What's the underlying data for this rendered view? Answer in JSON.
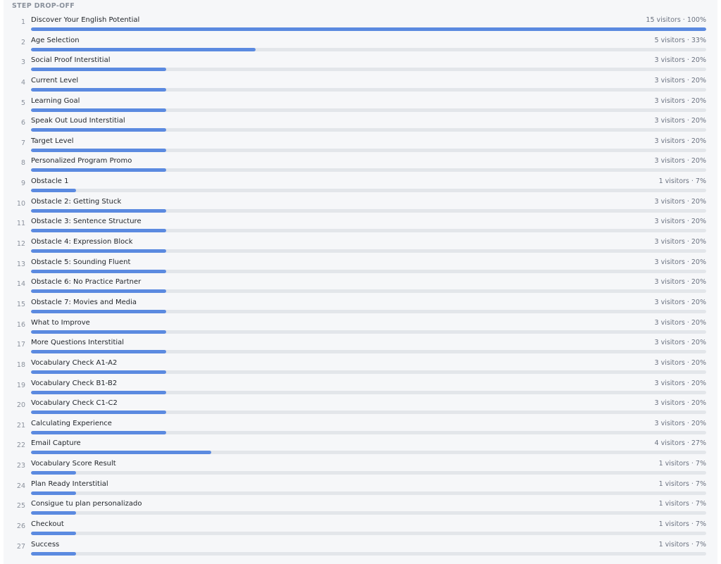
{
  "section": {
    "title": "STEP DROP-OFF"
  },
  "colors": {
    "bar_fill": "#5b8ae0",
    "bar_track": "#e3e6ea"
  },
  "steps": [
    {
      "num": "1",
      "label": "Discover Your English Potential",
      "stats": "15 visitors · 100%",
      "fraction": 1.0
    },
    {
      "num": "2",
      "label": "Age Selection",
      "stats": "5 visitors · 33%",
      "fraction": 0.333
    },
    {
      "num": "3",
      "label": "Social Proof Interstitial",
      "stats": "3 visitors · 20%",
      "fraction": 0.2
    },
    {
      "num": "4",
      "label": "Current Level",
      "stats": "3 visitors · 20%",
      "fraction": 0.2
    },
    {
      "num": "5",
      "label": "Learning Goal",
      "stats": "3 visitors · 20%",
      "fraction": 0.2
    },
    {
      "num": "6",
      "label": "Speak Out Loud Interstitial",
      "stats": "3 visitors · 20%",
      "fraction": 0.2
    },
    {
      "num": "7",
      "label": "Target Level",
      "stats": "3 visitors · 20%",
      "fraction": 0.2
    },
    {
      "num": "8",
      "label": "Personalized Program Promo",
      "stats": "3 visitors · 20%",
      "fraction": 0.2
    },
    {
      "num": "9",
      "label": "Obstacle 1",
      "stats": "1 visitors · 7%",
      "fraction": 0.067
    },
    {
      "num": "10",
      "label": "Obstacle 2: Getting Stuck",
      "stats": "3 visitors · 20%",
      "fraction": 0.2
    },
    {
      "num": "11",
      "label": "Obstacle 3: Sentence Structure",
      "stats": "3 visitors · 20%",
      "fraction": 0.2
    },
    {
      "num": "12",
      "label": "Obstacle 4: Expression Block",
      "stats": "3 visitors · 20%",
      "fraction": 0.2
    },
    {
      "num": "13",
      "label": "Obstacle 5: Sounding Fluent",
      "stats": "3 visitors · 20%",
      "fraction": 0.2
    },
    {
      "num": "14",
      "label": "Obstacle 6: No Practice Partner",
      "stats": "3 visitors · 20%",
      "fraction": 0.2
    },
    {
      "num": "15",
      "label": "Obstacle 7: Movies and Media",
      "stats": "3 visitors · 20%",
      "fraction": 0.2
    },
    {
      "num": "16",
      "label": "What to Improve",
      "stats": "3 visitors · 20%",
      "fraction": 0.2
    },
    {
      "num": "17",
      "label": "More Questions Interstitial",
      "stats": "3 visitors · 20%",
      "fraction": 0.2
    },
    {
      "num": "18",
      "label": "Vocabulary Check A1-A2",
      "stats": "3 visitors · 20%",
      "fraction": 0.2
    },
    {
      "num": "19",
      "label": "Vocabulary Check B1-B2",
      "stats": "3 visitors · 20%",
      "fraction": 0.2
    },
    {
      "num": "20",
      "label": "Vocabulary Check C1-C2",
      "stats": "3 visitors · 20%",
      "fraction": 0.2
    },
    {
      "num": "21",
      "label": "Calculating Experience",
      "stats": "3 visitors · 20%",
      "fraction": 0.2
    },
    {
      "num": "22",
      "label": "Email Capture",
      "stats": "4 visitors · 27%",
      "fraction": 0.267
    },
    {
      "num": "23",
      "label": "Vocabulary Score Result",
      "stats": "1 visitors · 7%",
      "fraction": 0.067
    },
    {
      "num": "24",
      "label": "Plan Ready Interstitial",
      "stats": "1 visitors · 7%",
      "fraction": 0.067
    },
    {
      "num": "25",
      "label": "Consigue tu plan personalizado",
      "stats": "1 visitors · 7%",
      "fraction": 0.067
    },
    {
      "num": "26",
      "label": "Checkout",
      "stats": "1 visitors · 7%",
      "fraction": 0.067
    },
    {
      "num": "27",
      "label": "Success",
      "stats": "1 visitors · 7%",
      "fraction": 0.067
    }
  ]
}
